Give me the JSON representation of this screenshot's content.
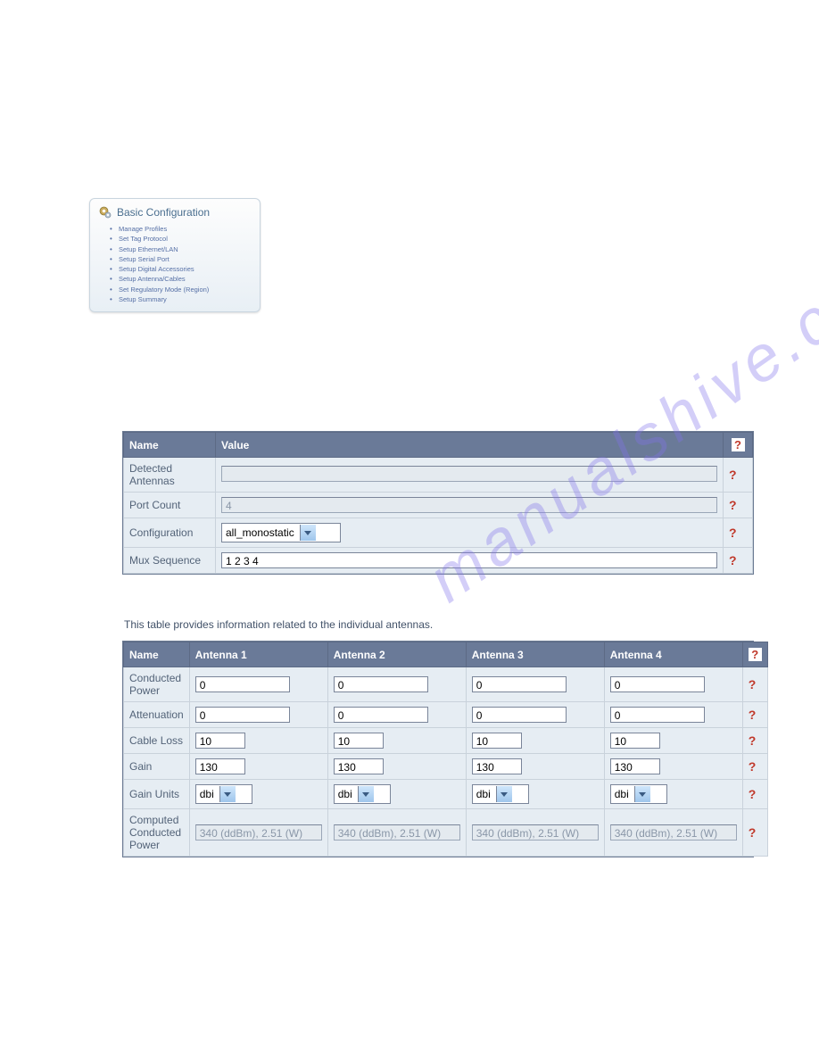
{
  "watermark": "manualshive.com",
  "config_card": {
    "title": "Basic Configuration",
    "items": [
      "Manage Profiles",
      "Set Tag Protocol",
      "Setup Ethernet/LAN",
      "Setup Serial Port",
      "Setup Digital Accessories",
      "Setup Antenna/Cables",
      "Set Regulatory Mode (Region)",
      "Setup Summary"
    ]
  },
  "help_glyph": "?",
  "table1": {
    "headers": {
      "name": "Name",
      "value": "Value"
    },
    "rows": [
      {
        "label": "Detected Antennas",
        "type": "readonly",
        "value": ""
      },
      {
        "label": "Port Count",
        "type": "readonly",
        "value": "4"
      },
      {
        "label": "Configuration",
        "type": "select",
        "value": "all_monostatic"
      },
      {
        "label": "Mux Sequence",
        "type": "input",
        "value": "1 2 3 4"
      }
    ]
  },
  "caption": "This table provides information related to the individual antennas.",
  "table2": {
    "headers": {
      "name": "Name",
      "cols": [
        "Antenna 1",
        "Antenna 2",
        "Antenna 3",
        "Antenna 4"
      ]
    },
    "rows": [
      {
        "label": "Conducted Power",
        "type": "input",
        "width": "w-100",
        "vals": [
          "0",
          "0",
          "0",
          "0"
        ]
      },
      {
        "label": "Attenuation",
        "type": "input",
        "width": "w-100",
        "vals": [
          "0",
          "0",
          "0",
          "0"
        ]
      },
      {
        "label": "Cable Loss",
        "type": "input",
        "width": "w-50",
        "vals": [
          "10",
          "10",
          "10",
          "10"
        ]
      },
      {
        "label": "Gain",
        "type": "input",
        "width": "w-50",
        "vals": [
          "130",
          "130",
          "130",
          "130"
        ]
      },
      {
        "label": "Gain Units",
        "type": "select",
        "vals": [
          "dbi",
          "dbi",
          "dbi",
          "dbi"
        ]
      },
      {
        "label": "Computed Conducted Power",
        "type": "readonly",
        "width": "w-ro",
        "vals": [
          "340 (ddBm), 2.51 (W)",
          "340 (ddBm), 2.51 (W)",
          "340 (ddBm), 2.51 (W)",
          "340 (ddBm), 2.51 (W)"
        ]
      }
    ]
  }
}
